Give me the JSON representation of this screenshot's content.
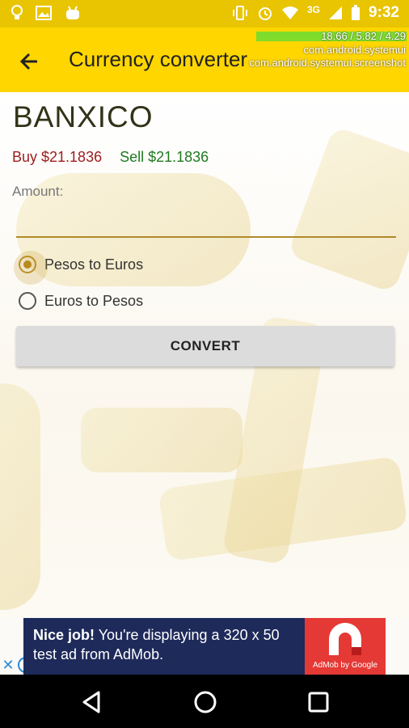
{
  "status_bar": {
    "network": "3G",
    "time": "9:32"
  },
  "app_bar": {
    "title": "Currency converter",
    "back_icon": "arrow-back-icon"
  },
  "overlay": {
    "line1": "18.66 / 5.82 / 4.29",
    "line2": "com.android.systemui",
    "line3": "com.android.systemui.screenshot"
  },
  "converter": {
    "bank_name": "BANXICO",
    "buy_label": "Buy $21.1836",
    "sell_label": "Sell $21.1836",
    "amount_label": "Amount:",
    "amount_value": "",
    "options": [
      {
        "label": "Pesos to Euros",
        "checked": true
      },
      {
        "label": "Euros to Pesos",
        "checked": false
      }
    ],
    "convert_label": "CONVERT"
  },
  "ad": {
    "headline": "Nice job!",
    "body": " You're displaying a 320 x 50 test ad from AdMob.",
    "logo_label": "AdMob by Google"
  },
  "colors": {
    "app_bar": "#ffd600",
    "status_bar": "#e9c400",
    "buy": "#9c1d1d",
    "sell": "#1f7a1f",
    "accent": "#b88a1e"
  }
}
